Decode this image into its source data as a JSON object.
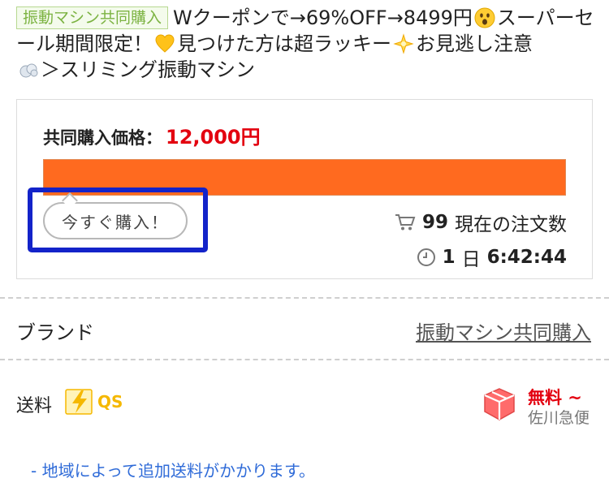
{
  "title": {
    "category_tag": "振動マシン共同購入",
    "text_part1": "Wクーポンで→69%OFF→8499円",
    "text_part2": "スーパーセール期間限定！",
    "text_part3": "見つけた方は超ラッキー",
    "text_part4": "お見逃し注意",
    "text_part5": "＞スリミング振動マシン",
    "emojis": [
      "surprised-face-emoji",
      "yellow-heart-emoji",
      "glowing-star-emoji",
      "dash-emoji"
    ]
  },
  "group_buy": {
    "price_label": "共同購入価格：",
    "price_value": "12,000円",
    "progress": 1.0,
    "buy_button_label": "今すぐ購入！",
    "order_count": "99",
    "order_count_label": "現在の注文数",
    "countdown_days": "1",
    "countdown_day_unit": "日",
    "countdown_time": "6:42:44"
  },
  "brand": {
    "label": "ブランド",
    "value": "振動マシン共同購入"
  },
  "shipping": {
    "label": "送料",
    "badge_text": "QS",
    "price": "無料 ~",
    "carrier": "佐川急便",
    "notice": "- 地域によって追加送料がかかります。"
  },
  "colors": {
    "price_red": "#e3000f",
    "progress_orange": "#ff6a1f",
    "highlight_blue": "#1323c9",
    "link_blue": "#2f6bd8",
    "qs_yellow": "#f5b800"
  }
}
